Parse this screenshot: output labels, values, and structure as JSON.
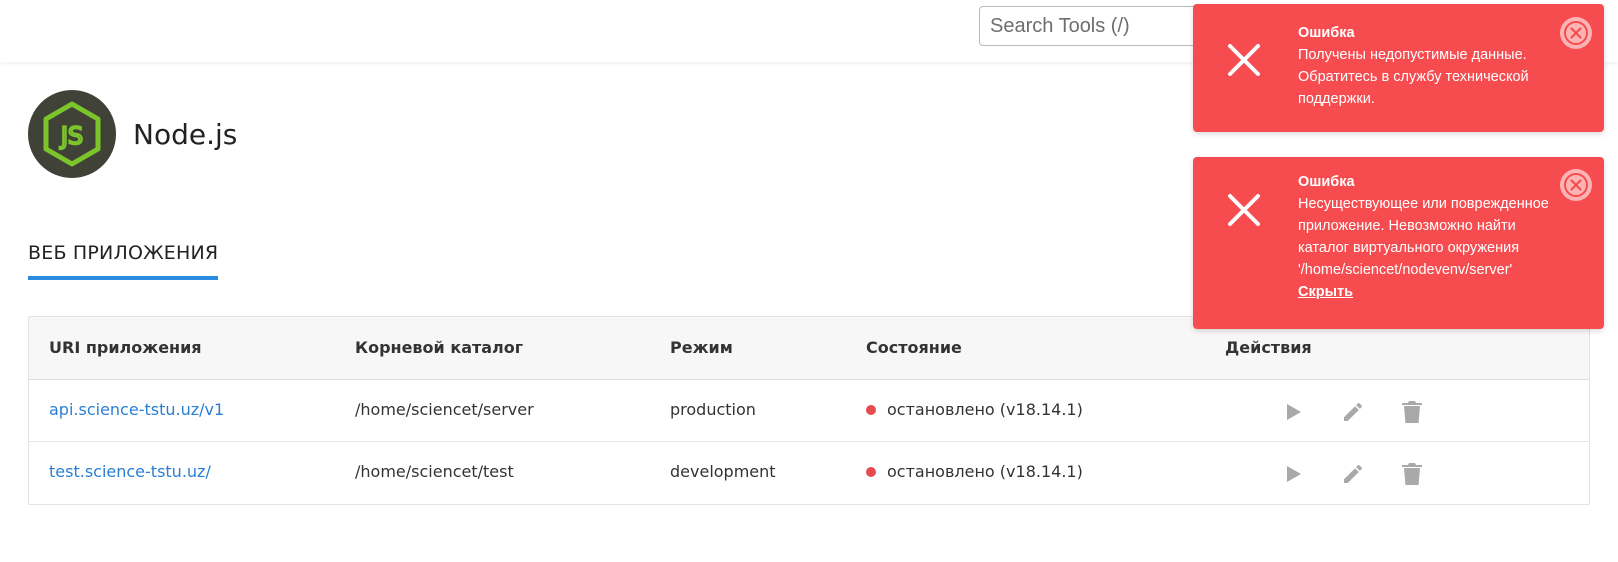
{
  "search": {
    "placeholder": "Search Tools (/)"
  },
  "app": {
    "title": "Node.js",
    "logo_icon": "nodejs-logo"
  },
  "tabs": [
    {
      "label": "ВЕБ ПРИЛОЖЕНИЯ",
      "active": true
    }
  ],
  "table": {
    "headers": [
      "URI приложения",
      "Корневой каталог",
      "Режим",
      "Состояние",
      "Действия"
    ],
    "rows": [
      {
        "uri": "api.science-tstu.uz/v1",
        "root": "/home/sciencet/server",
        "mode": "production",
        "status": "остановлено (v18.14.1)"
      },
      {
        "uri": "test.science-tstu.uz/",
        "root": "/home/sciencet/test",
        "mode": "development",
        "status": "остановлено (v18.14.1)"
      }
    ],
    "action_icons": [
      "play-icon",
      "edit-icon",
      "trash-icon"
    ]
  },
  "notifications": [
    {
      "title": "Ошибка",
      "lines": [
        "Получены недопустимые данные.",
        "Обратитесь в службу технической",
        "поддержки."
      ]
    },
    {
      "title": "Ошибка",
      "lines": [
        "Несуществующее или поврежденное",
        "приложение. Невозможно найти",
        "каталог виртуального окружения",
        "'/home/sciencet/nodevenv/server'"
      ],
      "hide_label": "Скрыть"
    }
  ],
  "colors": {
    "accent": "#2a8be0",
    "error": "#f64c4f",
    "link": "#2a7fd4",
    "status_stopped": "#e84b4f"
  }
}
